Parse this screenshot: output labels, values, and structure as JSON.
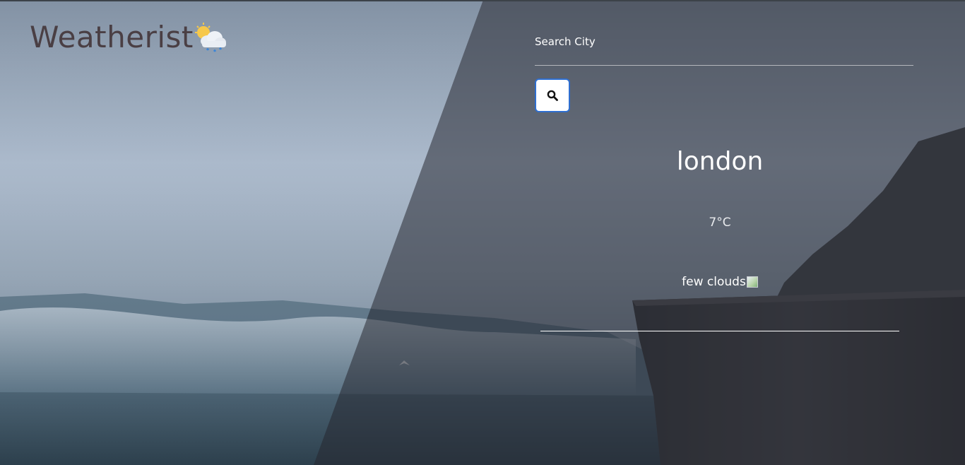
{
  "app": {
    "title": "Weatherist",
    "logo_icon": "sun-behind-rain-cloud-icon"
  },
  "search": {
    "label": "Search City",
    "value": "",
    "placeholder": "",
    "button_icon": "search-icon"
  },
  "weather": {
    "city": "london",
    "temperature": "7°C",
    "condition": "few clouds",
    "condition_icon": "broken-image-icon"
  },
  "colors": {
    "logo_text": "#4a3f44",
    "button_border": "#2f6fd0",
    "text": "#ffffff"
  }
}
